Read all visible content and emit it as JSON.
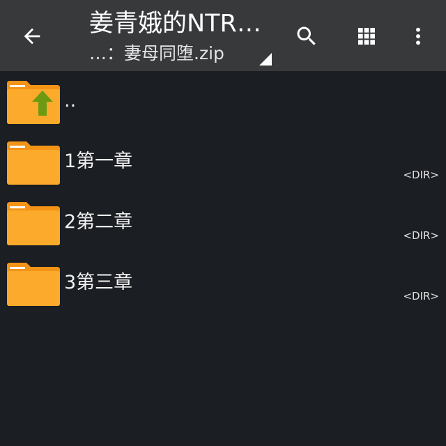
{
  "toolbar": {
    "title": "姜青娥的NTR…",
    "subtitle": "…：妻母同堕.zip",
    "back_icon": "arrow-left-icon",
    "search_icon": "search-icon",
    "grid_icon": "grid-view-icon",
    "menu_icon": "more-vert-icon"
  },
  "files": [
    {
      "name": "..",
      "size": "",
      "icon": "folder-up-icon"
    },
    {
      "name": "1第一章",
      "size": "<DIR>",
      "icon": "folder-icon"
    },
    {
      "name": "2第二章",
      "size": "<DIR>",
      "icon": "folder-icon"
    },
    {
      "name": "3第三章",
      "size": "<DIR>",
      "icon": "folder-icon"
    }
  ],
  "colors": {
    "toolbar_bg": "#37393b",
    "list_bg": "#1b1e23",
    "folder_orange": "#fcaa2b",
    "folder_tab": "#f39417",
    "up_arrow_green": "#6d9a12"
  }
}
